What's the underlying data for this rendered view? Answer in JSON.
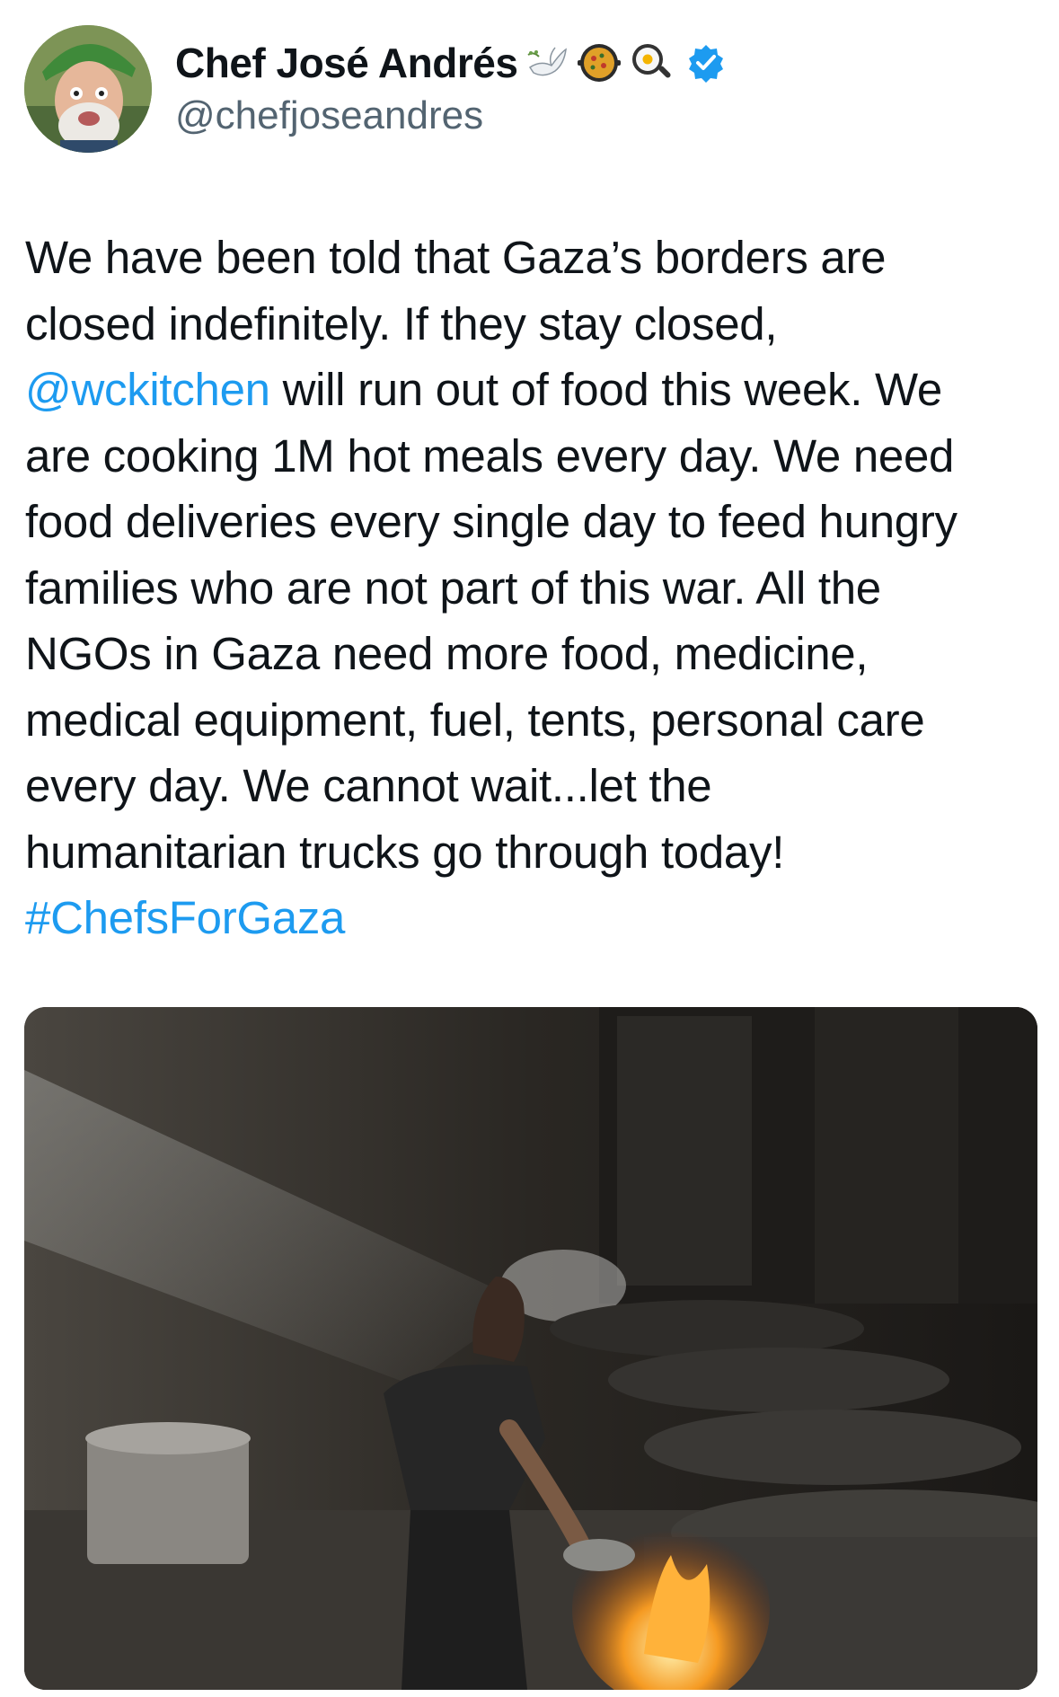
{
  "author": {
    "display_name": "Chef José Andrés",
    "handle": "@chefjoseandres",
    "emoji_icons": [
      "dove-icon",
      "paella-pan-icon",
      "frying-pan-egg-icon"
    ],
    "verified": true,
    "verified_color": "#1d9bf0"
  },
  "tweet": {
    "lines": [
      [
        {
          "text": "We have been told that Gaza’s borders are"
        }
      ],
      [
        {
          "text": "closed indefinitely. If they stay closed,"
        }
      ],
      [
        {
          "text": "@wckitchen",
          "link": true
        },
        {
          "text": " will run out of food this week. We"
        }
      ],
      [
        {
          "text": "are cooking 1M hot meals every day. We need"
        }
      ],
      [
        {
          "text": "food deliveries every single day to feed hungry"
        }
      ],
      [
        {
          "text": "families who are not part of this war. All the"
        }
      ],
      [
        {
          "text": "NGOs in Gaza need more food, medicine,"
        }
      ],
      [
        {
          "text": "medical equipment, fuel, tents, personal care"
        }
      ],
      [
        {
          "text": "every day. We cannot wait...let the"
        }
      ],
      [
        {
          "text": "humanitarian trucks go through today!"
        }
      ],
      [
        {
          "text": "#ChefsForGaza",
          "link": true
        }
      ]
    ],
    "link_color": "#1d9bf0"
  },
  "media": {
    "icon": "photo-cook-with-giant-pots"
  }
}
